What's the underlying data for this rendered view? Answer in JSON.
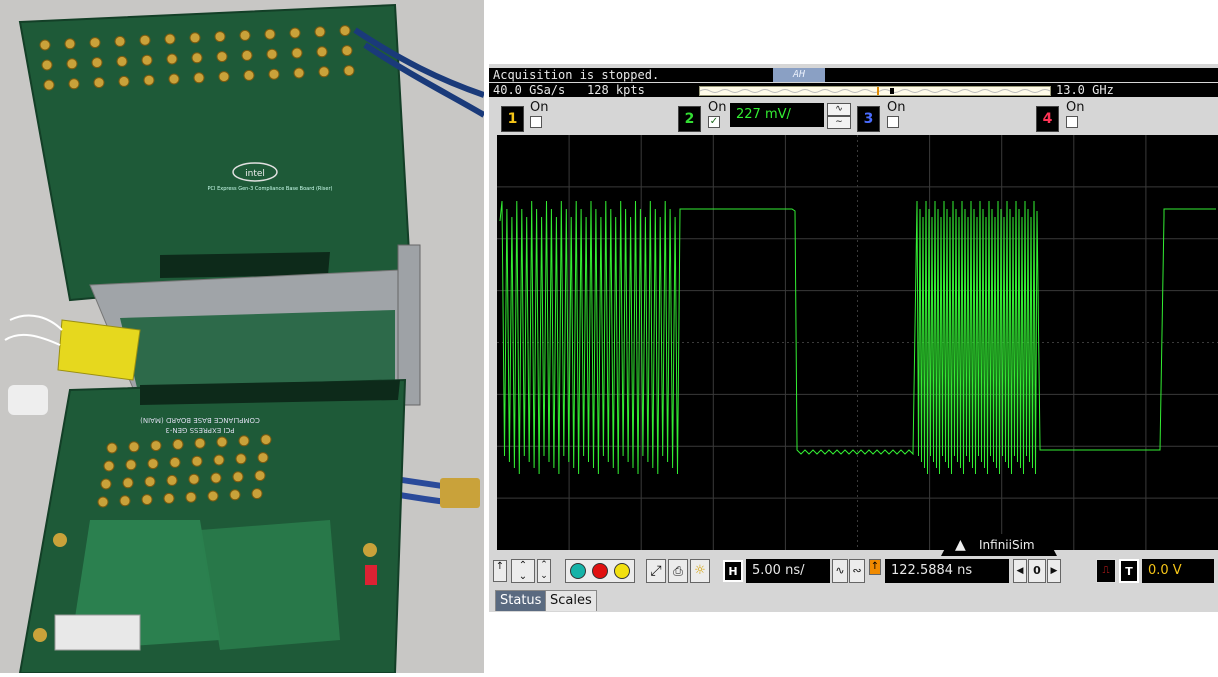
{
  "status": {
    "acquisition": "Acquisition is stopped.",
    "sample_rate": "40.0 GSa/s",
    "memory_depth": "128 kpts",
    "bandwidth": "13.0 GHz"
  },
  "channels": [
    {
      "number": "1",
      "label": "On",
      "checked": false,
      "color": "#f5c518"
    },
    {
      "number": "2",
      "label": "On",
      "checked": true,
      "color": "#33dd33",
      "scale": "227 mV/"
    },
    {
      "number": "3",
      "label": "On",
      "checked": false,
      "color": "#4a6cff"
    },
    {
      "number": "4",
      "label": "On",
      "checked": false,
      "color": "#ff3355"
    }
  ],
  "timebase": {
    "h_label": "H",
    "scale": "5.00 ns/",
    "position": "122.5884 ns",
    "delay_ref": "0"
  },
  "trigger": {
    "t_label": "T",
    "level": "0.0 V"
  },
  "tabs": [
    "Status",
    "Scales"
  ],
  "infinii_tab": "InfiniiSim",
  "photo": {
    "board_text_1": "PCI EXPRESS GEN-3",
    "board_text_2": "COMPLIANCE BASE BOARD (MAIN)",
    "riser_text": "PCI Express Gen-3 Compliance Base Board (Riser)",
    "logo": "intel"
  },
  "colors": {
    "trace": "#33ee33",
    "grid": "#3a3a3a",
    "pcb": "#1e5a38"
  }
}
